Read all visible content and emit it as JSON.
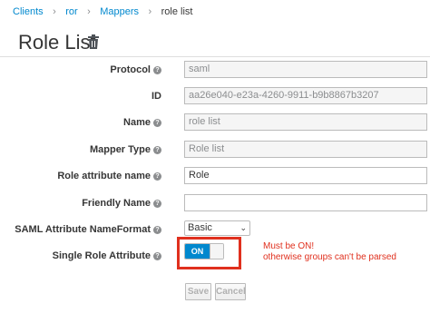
{
  "breadcrumb": {
    "items": [
      "Clients",
      "ror",
      "Mappers"
    ],
    "current": "role list",
    "separator": "›"
  },
  "page": {
    "title": "Role List",
    "delete_icon": "trash-icon"
  },
  "form": {
    "help_glyph": "?",
    "protocol": {
      "label": "Protocol",
      "value": "saml"
    },
    "id": {
      "label": "ID",
      "value": "aa26e040-e23a-4260-9911-b9b8867b3207"
    },
    "name": {
      "label": "Name",
      "value": "role list"
    },
    "mapper_type": {
      "label": "Mapper Type",
      "value": "Role list"
    },
    "role_attribute_name": {
      "label": "Role attribute name",
      "value": "Role"
    },
    "friendly_name": {
      "label": "Friendly Name",
      "value": ""
    },
    "saml_nameformat": {
      "label": "SAML Attribute NameFormat",
      "selected": "Basic"
    },
    "single_role_attribute": {
      "label": "Single Role Attribute",
      "toggle_label": "ON",
      "state": true
    }
  },
  "annotation": {
    "line1": "Must be ON!",
    "line2": "otherwise groups can't be parsed",
    "color": "#e0301e"
  },
  "actions": {
    "save_label": "Save",
    "cancel_label": "Cancel"
  },
  "colors": {
    "link": "#0088ce",
    "toggle_on": "#0088ce"
  }
}
